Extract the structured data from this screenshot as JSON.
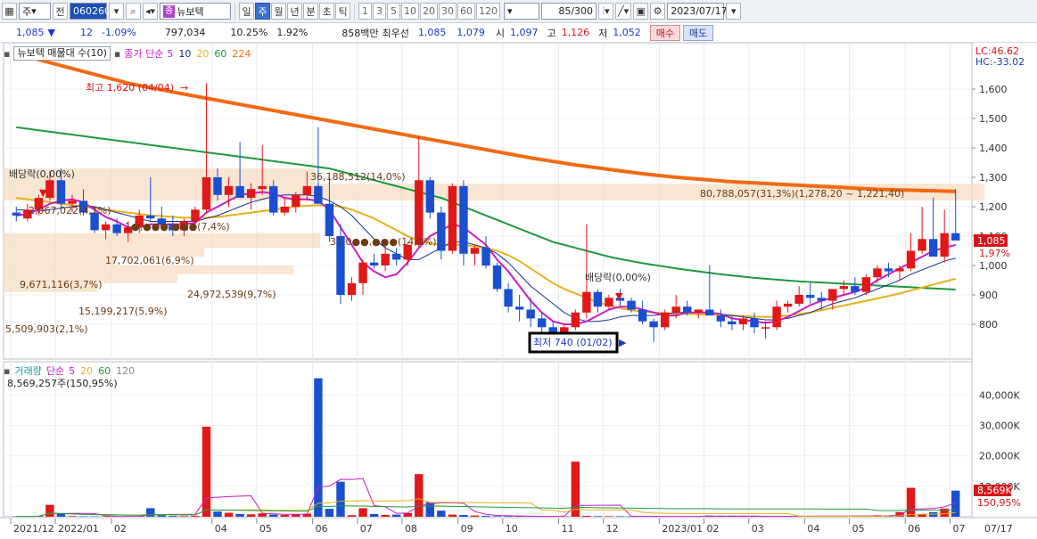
{
  "toolbar": {
    "market_label": "주",
    "prev_label": "전",
    "code": "060260",
    "stock_name": "뉴보텍",
    "stock_tag": "종",
    "periods": [
      "일",
      "주",
      "월",
      "년",
      "분",
      "초",
      "틱"
    ],
    "selected_period": "주",
    "intervals": [
      "1",
      "3",
      "5",
      "10",
      "20",
      "30",
      "60",
      "120"
    ],
    "count": "85",
    "count_total": "/300",
    "date": "2023/07/17"
  },
  "quote": {
    "price": "1,085",
    "change": "12",
    "change_pct": "-1.09%",
    "volume": "797,034",
    "turnover_pct": "10.25%",
    "ratio": "1.92%",
    "amount": "858백만",
    "ask_label": "최우선",
    "ask": "1,085",
    "bid": "1,079",
    "open_label": "시",
    "open": "1,097",
    "high_label": "고",
    "high": "1,126",
    "low_label": "저",
    "low": "1,052",
    "buy_label": "매수",
    "sell_label": "매도"
  },
  "legend": {
    "main_title": "뉴보텍 매물대 수(10)",
    "ma_label": "종가 단순",
    "ma_periods": [
      "5",
      "10",
      "20",
      "60",
      "224"
    ],
    "ma_colors": [
      "#c81cc8",
      "#1a2f90",
      "#e8b01a",
      "#1c9a3c",
      "#f06a12"
    ],
    "lc": "LC:46.62",
    "hc": "HC:-33.02",
    "vol_title": "거래량",
    "vol_ma_label": "단순",
    "vol_periods": [
      "5",
      "20",
      "60",
      "120"
    ],
    "vol_info": "8,569,257주(150,95%)"
  },
  "annotations": {
    "high_label": "최고 1,620 (04/04)",
    "low_label": "최저 740 (01/02)",
    "dividend1": "배당락(0,00%)",
    "dividend2": "배당락(0,00%)",
    "current_price_tag": "1,085",
    "current_pct_tag": "1,97%",
    "vol_tag": "8,569K",
    "vol_pct_tag": "150,95%"
  },
  "chart_data": {
    "type": "candlestick",
    "y_ticks": [
      "1,600",
      "1,500",
      "1,400",
      "1,300",
      "1,200",
      "1,100",
      "1,000",
      "900",
      "800"
    ],
    "y_values": [
      1600,
      1500,
      1400,
      1300,
      1200,
      1100,
      1000,
      900,
      800
    ],
    "ylim": [
      700,
      1700
    ],
    "vol_ticks": [
      "40,000K",
      "30,000K",
      "20,000K",
      "10,000K"
    ],
    "vol_values": [
      40000,
      30000,
      20000,
      10000
    ],
    "vol_max": 48000,
    "x_labels": [
      "2021/12",
      "2022/01",
      "02",
      "04",
      "05",
      "06",
      "07",
      "08",
      "09",
      "10",
      "11",
      "12",
      "2023/01",
      "02",
      "03",
      "04",
      "05",
      "06",
      "07",
      "07/17"
    ],
    "x_label_weeks": [
      0,
      4,
      9,
      18,
      22,
      27,
      31,
      35,
      40,
      44,
      49,
      53,
      58,
      62,
      66,
      71,
      75,
      80,
      84,
      92
    ],
    "volume_profile": [
      {
        "label": "9,671,116(3,7%)",
        "price": 1000
      },
      {
        "label": "17,702,061(6,9%)",
        "price": 1015
      },
      {
        "label": "24,972,539(9,7%)",
        "price": 975
      },
      {
        "label": "15,199,217(5,9%)",
        "price": 940
      },
      {
        "label": "5,509,903(2,1%)",
        "price": 885
      },
      {
        "label": "31,0●●,●●●(14,0%)",
        "price": 1080
      },
      {
        "label": "1●,●●●,●●●(7,4%)",
        "price": 1110
      },
      {
        "label": "2,067,022(4,1%)",
        "price": 1185
      },
      {
        "label": "36,188,512(14,0%)",
        "price": 1300
      },
      {
        "label": "80,788,057(31,3%)(1,278,20 ~ 1,221,40)",
        "price": 1250
      }
    ],
    "profile_bars": [
      {
        "from": 1278,
        "to": 1221,
        "len": 1100
      },
      {
        "from": 1330,
        "to": 1278,
        "len": 350
      },
      {
        "from": 1110,
        "to": 1060,
        "len": 355
      },
      {
        "from": 1060,
        "to": 1030,
        "len": 225
      },
      {
        "from": 1030,
        "to": 1000,
        "len": 125
      },
      {
        "from": 1000,
        "to": 970,
        "len": 325
      },
      {
        "from": 970,
        "to": 940,
        "len": 195
      },
      {
        "from": 940,
        "to": 910,
        "len": 105
      }
    ],
    "candles": [
      [
        1180,
        1200,
        1150,
        1170
      ],
      [
        1160,
        1210,
        1150,
        1190
      ],
      [
        1190,
        1240,
        1170,
        1230
      ],
      [
        1230,
        1320,
        1220,
        1290
      ],
      [
        1290,
        1330,
        1190,
        1210
      ],
      [
        1210,
        1240,
        1180,
        1220
      ],
      [
        1220,
        1260,
        1170,
        1180
      ],
      [
        1180,
        1200,
        1110,
        1120
      ],
      [
        1120,
        1150,
        1090,
        1140
      ],
      [
        1140,
        1160,
        1100,
        1110
      ],
      [
        1110,
        1150,
        1080,
        1130
      ],
      [
        1130,
        1190,
        1110,
        1170
      ],
      [
        1170,
        1300,
        1150,
        1160
      ],
      [
        1160,
        1200,
        1120,
        1140
      ],
      [
        1140,
        1170,
        1100,
        1120
      ],
      [
        1120,
        1160,
        1100,
        1150
      ],
      [
        1150,
        1200,
        1140,
        1190
      ],
      [
        1190,
        1620,
        1180,
        1300
      ],
      [
        1300,
        1330,
        1220,
        1240
      ],
      [
        1240,
        1300,
        1200,
        1270
      ],
      [
        1270,
        1420,
        1250,
        1230
      ],
      [
        1230,
        1280,
        1190,
        1260
      ],
      [
        1260,
        1410,
        1240,
        1270
      ],
      [
        1270,
        1290,
        1170,
        1180
      ],
      [
        1180,
        1230,
        1170,
        1200
      ],
      [
        1200,
        1250,
        1180,
        1240
      ],
      [
        1240,
        1320,
        1220,
        1270
      ],
      [
        1270,
        1470,
        1250,
        1210
      ],
      [
        1210,
        1300,
        1080,
        1100
      ],
      [
        1100,
        1140,
        870,
        900
      ],
      [
        900,
        960,
        880,
        940
      ],
      [
        940,
        1020,
        900,
        1010
      ],
      [
        1010,
        1040,
        990,
        1000
      ],
      [
        1000,
        1070,
        980,
        1040
      ],
      [
        1040,
        1060,
        1000,
        1020
      ],
      [
        1020,
        1080,
        1000,
        1070
      ],
      [
        1070,
        1440,
        1060,
        1290
      ],
      [
        1290,
        1300,
        1160,
        1180
      ],
      [
        1180,
        1200,
        1020,
        1050
      ],
      [
        1050,
        1280,
        1040,
        1270
      ],
      [
        1270,
        1290,
        1000,
        1040
      ],
      [
        1040,
        1070,
        1000,
        1060
      ],
      [
        1060,
        1100,
        990,
        1000
      ],
      [
        1000,
        1010,
        910,
        920
      ],
      [
        920,
        940,
        840,
        860
      ],
      [
        860,
        900,
        810,
        850
      ],
      [
        850,
        890,
        790,
        820
      ],
      [
        820,
        840,
        760,
        790
      ],
      [
        790,
        810,
        760,
        770
      ],
      [
        770,
        800,
        750,
        790
      ],
      [
        790,
        850,
        780,
        840
      ],
      [
        840,
        1140,
        820,
        910
      ],
      [
        910,
        920,
        840,
        860
      ],
      [
        860,
        900,
        850,
        890
      ],
      [
        890,
        920,
        860,
        880
      ],
      [
        880,
        890,
        840,
        850
      ],
      [
        850,
        880,
        800,
        810
      ],
      [
        810,
        820,
        740,
        790
      ],
      [
        790,
        850,
        780,
        840
      ],
      [
        840,
        900,
        820,
        860
      ],
      [
        860,
        880,
        830,
        840
      ],
      [
        840,
        850,
        820,
        850
      ],
      [
        850,
        1000,
        840,
        830
      ],
      [
        830,
        850,
        790,
        810
      ],
      [
        810,
        830,
        780,
        800
      ],
      [
        800,
        830,
        780,
        820
      ],
      [
        820,
        840,
        770,
        790
      ],
      [
        790,
        810,
        750,
        790
      ],
      [
        790,
        880,
        780,
        860
      ],
      [
        860,
        880,
        840,
        870
      ],
      [
        870,
        930,
        860,
        900
      ],
      [
        900,
        940,
        870,
        890
      ],
      [
        890,
        910,
        850,
        880
      ],
      [
        880,
        900,
        850,
        920
      ],
      [
        920,
        950,
        900,
        930
      ],
      [
        930,
        960,
        900,
        910
      ],
      [
        910,
        970,
        900,
        960
      ],
      [
        960,
        1000,
        940,
        990
      ],
      [
        990,
        1010,
        960,
        980
      ],
      [
        980,
        1000,
        950,
        990
      ],
      [
        990,
        1110,
        980,
        1050
      ],
      [
        1050,
        1200,
        1040,
        1090
      ],
      [
        1090,
        1230,
        1060,
        1030
      ],
      [
        1030,
        1190,
        1010,
        1110
      ],
      [
        1110,
        1260,
        1090,
        1085
      ]
    ],
    "volumes": [
      120,
      180,
      260,
      3900,
      900,
      200,
      150,
      120,
      140,
      110,
      100,
      160,
      2800,
      500,
      260,
      210,
      300,
      29600,
      1700,
      1300,
      900,
      800,
      1100,
      700,
      600,
      800,
      1000,
      45500,
      2600,
      11500,
      500,
      2800,
      900,
      600,
      700,
      1200,
      14000,
      4800,
      2000,
      700,
      600,
      400,
      300,
      200,
      200,
      150,
      120,
      100,
      90,
      110,
      18100,
      300,
      200,
      180,
      160,
      150,
      120,
      100,
      110,
      150,
      140,
      120,
      400,
      200,
      150,
      140,
      200,
      100,
      150,
      180,
      200,
      300,
      250,
      220,
      200,
      240,
      300,
      500,
      400,
      1500,
      9500,
      900,
      1500,
      2700,
      8569
    ],
    "ma5": [
      1170,
      1175,
      1190,
      1210,
      1220,
      1225,
      1215,
      1190,
      1165,
      1150,
      1130,
      1130,
      1140,
      1140,
      1140,
      1140,
      1145,
      1180,
      1200,
      1220,
      1240,
      1245,
      1250,
      1245,
      1230,
      1225,
      1225,
      1220,
      1190,
      1130,
      1070,
      1010,
      980,
      960,
      970,
      1010,
      1060,
      1100,
      1120,
      1140,
      1130,
      1100,
      1070,
      1020,
      980,
      930,
      880,
      840,
      810,
      800,
      800,
      810,
      830,
      850,
      860,
      860,
      850,
      840,
      830,
      830,
      840,
      840,
      840,
      835,
      820,
      815,
      810,
      805,
      810,
      825,
      845,
      865,
      880,
      890,
      900,
      910,
      925,
      950,
      970,
      990,
      1010,
      1030,
      1050,
      1060,
      1070
    ],
    "ma10": [
      1190,
      1188,
      1185,
      1190,
      1195,
      1200,
      1205,
      1200,
      1190,
      1180,
      1170,
      1160,
      1150,
      1150,
      1150,
      1150,
      1150,
      1160,
      1170,
      1185,
      1200,
      1215,
      1225,
      1235,
      1240,
      1240,
      1240,
      1235,
      1220,
      1200,
      1170,
      1130,
      1090,
      1060,
      1040,
      1020,
      1020,
      1040,
      1060,
      1080,
      1080,
      1070,
      1060,
      1040,
      1010,
      970,
      930,
      900,
      870,
      840,
      820,
      810,
      810,
      815,
      825,
      830,
      830,
      830,
      835,
      840,
      840,
      840,
      840,
      835,
      830,
      825,
      820,
      815,
      815,
      820,
      830,
      840,
      855,
      870,
      880,
      890,
      905,
      920,
      935,
      950,
      970,
      985,
      1000,
      1015,
      1025
    ],
    "ma20": [
      1230,
      1225,
      1220,
      1215,
      1210,
      1205,
      1200,
      1195,
      1190,
      1185,
      1180,
      1175,
      1170,
      1168,
      1165,
      1163,
      1162,
      1163,
      1165,
      1170,
      1175,
      1180,
      1185,
      1190,
      1195,
      1200,
      1203,
      1205,
      1205,
      1200,
      1190,
      1175,
      1160,
      1140,
      1120,
      1100,
      1085,
      1075,
      1070,
      1070,
      1070,
      1065,
      1060,
      1050,
      1035,
      1015,
      990,
      965,
      940,
      920,
      905,
      890,
      875,
      865,
      855,
      848,
      843,
      840,
      838,
      836,
      835,
      834,
      833,
      832,
      830,
      828,
      826,
      825,
      826,
      830,
      835,
      840,
      848,
      856,
      864,
      872,
      880,
      888,
      896,
      905,
      915,
      925,
      935,
      945,
      955
    ],
    "ma60": [
      1470,
      1465,
      1460,
      1455,
      1450,
      1445,
      1440,
      1435,
      1430,
      1425,
      1420,
      1415,
      1410,
      1405,
      1400,
      1395,
      1390,
      1385,
      1380,
      1375,
      1370,
      1365,
      1360,
      1355,
      1350,
      1345,
      1340,
      1335,
      1330,
      1320,
      1310,
      1300,
      1290,
      1280,
      1270,
      1260,
      1250,
      1240,
      1230,
      1215,
      1200,
      1185,
      1170,
      1155,
      1140,
      1125,
      1110,
      1095,
      1080,
      1070,
      1060,
      1050,
      1040,
      1030,
      1022,
      1015,
      1008,
      1002,
      996,
      990,
      985,
      980,
      975,
      970,
      966,
      962,
      958,
      955,
      952,
      949,
      946,
      944,
      942,
      940,
      938,
      936,
      934,
      932,
      930,
      928,
      926,
      924,
      922,
      920,
      918
    ],
    "ma224": [
      1715,
      1710,
      1700,
      1690,
      1680,
      1670,
      1660,
      1650,
      1640,
      1630,
      1620,
      1612,
      1605,
      1598,
      1590,
      1583,
      1576,
      1569,
      1562,
      1555,
      1548,
      1541,
      1534,
      1527,
      1520,
      1513,
      1506,
      1499,
      1492,
      1485,
      1478,
      1471,
      1464,
      1457,
      1450,
      1443,
      1436,
      1429,
      1422,
      1415,
      1408,
      1401,
      1394,
      1387,
      1380,
      1373,
      1366,
      1360,
      1354,
      1348,
      1342,
      1337,
      1332,
      1327,
      1322,
      1317,
      1312,
      1308,
      1304,
      1300,
      1297,
      1294,
      1291,
      1288,
      1285,
      1283,
      1281,
      1279,
      1277,
      1275,
      1273,
      1271,
      1269,
      1267,
      1265,
      1263,
      1261,
      1259,
      1258,
      1257,
      1256,
      1255,
      1254,
      1253,
      1252
    ]
  }
}
